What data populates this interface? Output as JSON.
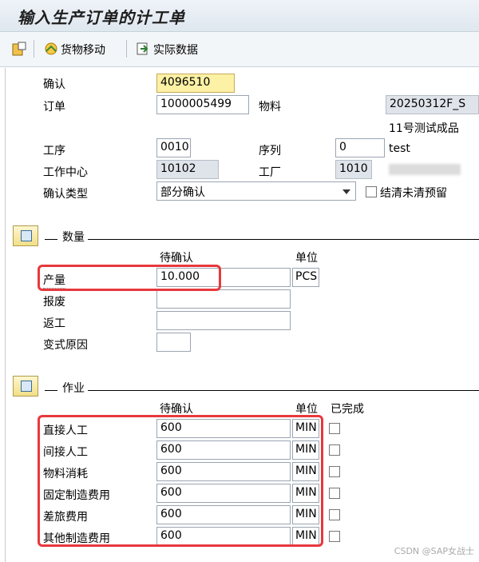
{
  "title": "输入生产订单的计工单",
  "toolbar": {
    "goods_movement": "货物移动",
    "actual_data": "实际数据"
  },
  "header": {
    "confirmation_label": "确认",
    "confirmation_value": "4096510",
    "order_label": "订单",
    "order_value": "1000005499",
    "material_label": "物料",
    "material_value": "20250312F_S",
    "material_desc": "11号测试成品",
    "operation_label": "工序",
    "operation_value": "0010",
    "sequence_label": "序列",
    "sequence_value": "0",
    "sequence_text": "test",
    "workcenter_label": "工作中心",
    "workcenter_value": "10102",
    "plant_label": "工厂",
    "plant_value": "1010",
    "conf_type_label": "确认类型",
    "conf_type_value": "部分确认",
    "clear_reservations": "结清未清预留"
  },
  "quantity": {
    "section_title": "数量",
    "col_to_confirm": "待确认",
    "col_unit": "单位",
    "rows": [
      {
        "label": "产量",
        "value": "10.000",
        "unit": "PCS"
      },
      {
        "label": "报废",
        "value": "",
        "unit": ""
      },
      {
        "label": "返工",
        "value": "",
        "unit": ""
      },
      {
        "label": "变式原因",
        "value": "",
        "unit": ""
      }
    ]
  },
  "activities": {
    "section_title": "作业",
    "col_to_confirm": "待确认",
    "col_unit": "单位",
    "col_done": "已完成",
    "rows": [
      {
        "label": "直接人工",
        "value": "600",
        "unit": "MIN"
      },
      {
        "label": "间接人工",
        "value": "600",
        "unit": "MIN"
      },
      {
        "label": "物料消耗",
        "value": "600",
        "unit": "MIN"
      },
      {
        "label": "固定制造费用",
        "value": "600",
        "unit": "MIN"
      },
      {
        "label": "差旅费用",
        "value": "600",
        "unit": "MIN"
      },
      {
        "label": "其他制造费用",
        "value": "600",
        "unit": "MIN"
      }
    ]
  },
  "watermark": "CSDN @SAP女战士",
  "colors": {
    "highlight": "#e8383d",
    "readonly": "#dfe3ea",
    "focus": "#fcf1a5"
  }
}
